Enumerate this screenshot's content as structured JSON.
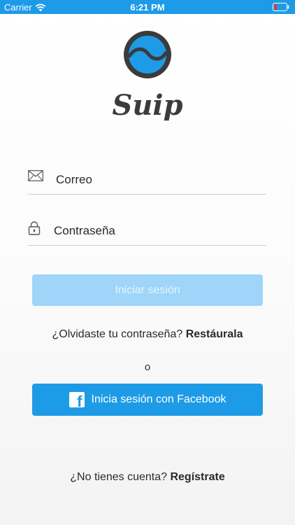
{
  "status_bar": {
    "carrier": "Carrier",
    "time": "6:21 PM",
    "color": "#1e9be7"
  },
  "logo": {
    "text": "Suip",
    "icon": "wave-circle-logo"
  },
  "form": {
    "email": {
      "placeholder": "Correo",
      "value": "",
      "icon": "envelope-icon"
    },
    "password": {
      "placeholder": "Contraseña",
      "value": "",
      "icon": "padlock-icon"
    }
  },
  "buttons": {
    "login": "Iniciar sesión",
    "facebook": "Inicia sesión con Facebook",
    "facebook_icon": "facebook-icon"
  },
  "forgot": {
    "prefix": "¿Olvidaste tu contraseña? ",
    "link": "Restáurala"
  },
  "separator": "o",
  "register": {
    "prefix": "¿No tienes cuenta? ",
    "link": "Regístrate"
  },
  "colors": {
    "accent": "#1e9be7",
    "login_disabled": "#9ed5f8",
    "text": "#2a2a2a"
  }
}
